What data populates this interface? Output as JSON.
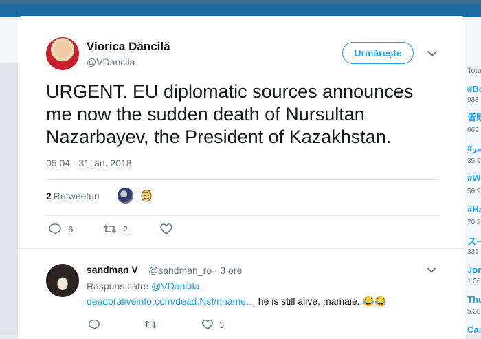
{
  "sidebar": {
    "header": "Tota",
    "trends": [
      {
        "tag": "#Bo",
        "count": "933"
      },
      {
        "tag": "皆既",
        "count": "669"
      },
      {
        "tag": "#قمر",
        "count": "35,9"
      },
      {
        "tag": "#W",
        "count": "56,9"
      },
      {
        "tag": "#Ha",
        "count": "70,2"
      },
      {
        "tag": "スー",
        "count": "331"
      },
      {
        "tag": "Jor",
        "count": "1.36"
      },
      {
        "tag": "Thu",
        "count": "5.38"
      },
      {
        "tag": "Car",
        "count": ""
      }
    ]
  },
  "tweet": {
    "author_name": "Viorica Dăncilă",
    "author_handle": "@VDancila",
    "follow_label": "Urmărește",
    "text": "URGENT. EU diplomatic sources announces me now the sudden death of Nursultan Nazarbayev, the President of Kazakhstan.",
    "timestamp": "05:04 - 31 ian. 2018",
    "retweet_count": "2",
    "retweet_label": "Retweeturi",
    "reply_count": "6",
    "retweet_action_count": "2",
    "like_count": ""
  },
  "reply": {
    "author_name": "sandman V",
    "author_handle": "@sandman_ro · 3 ore",
    "replying_prefix": "Răspuns către",
    "replying_to": "@VDancila",
    "link_text": "deadoraliveinfo.com/dead.Nsf/nname…",
    "text": " he is still alive, mamaie. 😂😂",
    "reply_count": "",
    "retweet_count": "",
    "like_count": "3"
  },
  "colors": {
    "accent": "#1da1f2",
    "text": "#14171a",
    "muted": "#657786",
    "topbar": "#1b6aa0"
  }
}
